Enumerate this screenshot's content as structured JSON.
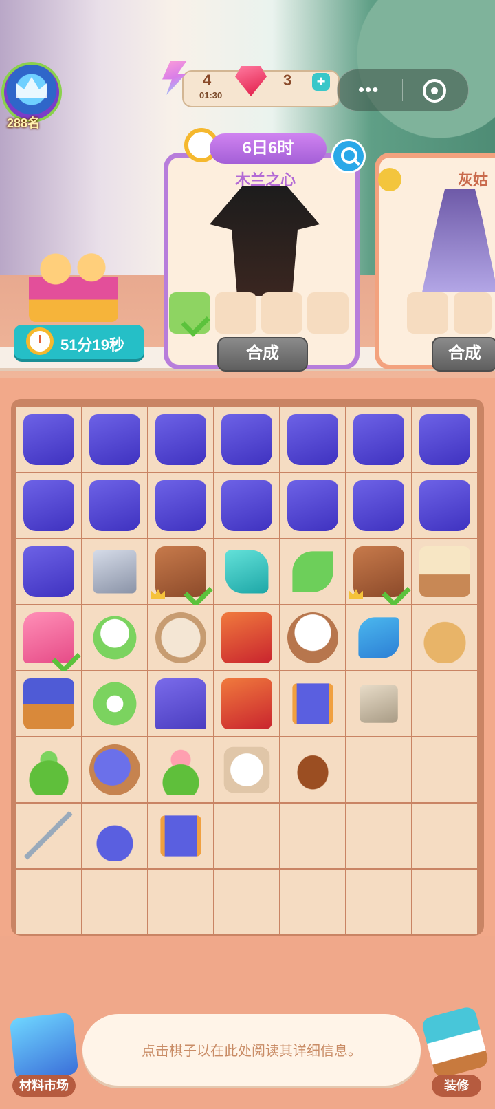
{
  "header": {
    "rank": "288名",
    "energy": "4",
    "energy_timer": "01:30",
    "gems": "3",
    "plus": "+"
  },
  "gift": {
    "timer": "51分19秒"
  },
  "cards": [
    {
      "countdown": "6日6时",
      "title": "木兰之心",
      "button": "合成"
    },
    {
      "title": "灰姑",
      "button": "合成"
    }
  ],
  "board": {
    "rows": [
      [
        "box",
        "box",
        "box",
        "box",
        "box",
        "box",
        "box"
      ],
      [
        "box",
        "box",
        "box",
        "box",
        "box",
        "box",
        "box"
      ],
      [
        "box",
        "stone",
        "bag-check",
        "cloth",
        "leaf",
        "bag-check",
        "sprout"
      ],
      [
        "machine-check",
        "dog",
        "rolls",
        "wood",
        "cotton",
        "scoop",
        "sack"
      ],
      [
        "spool-machine",
        "worm",
        "sewing",
        "wood",
        "spool",
        "rocks",
        ""
      ],
      [
        "plant",
        "yarn",
        "flower",
        "cottonpile",
        "seed",
        "",
        ""
      ],
      [
        "needle",
        "pincushion",
        "spool",
        "",
        "",
        "",
        ""
      ],
      [
        "",
        "",
        "",
        "",
        "",
        "",
        ""
      ]
    ]
  },
  "footer": {
    "info": "点击棋子以在此处阅读其详细信息。",
    "market_label": "材料市场",
    "decor_label": "装修"
  }
}
